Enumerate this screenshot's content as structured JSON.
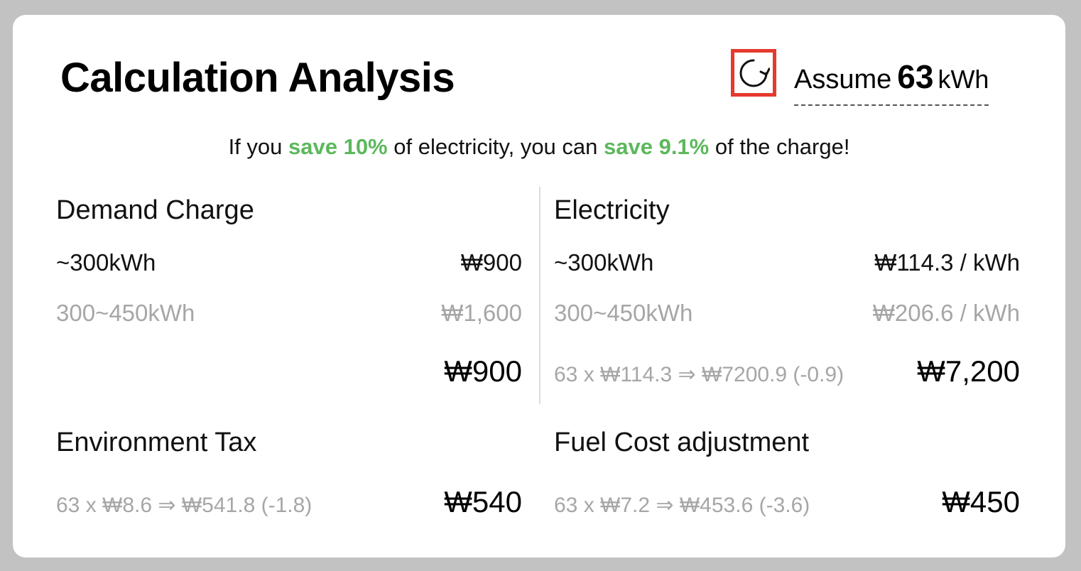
{
  "header": {
    "title": "Calculation Analysis",
    "assume_word": "Assume",
    "assume_value": "63",
    "assume_unit": "kWh"
  },
  "summary": {
    "part1": "If you ",
    "hl1": "save 10%",
    "part2": " of electricity, you can ",
    "hl2": "save 9.1%",
    "part3": " of the charge!"
  },
  "demand_charge": {
    "title": "Demand Charge",
    "tiers": [
      {
        "range": "~300kWh",
        "price": "₩900"
      },
      {
        "range": "300~450kWh",
        "price": "₩1,600"
      }
    ],
    "calc": "",
    "total": "₩900"
  },
  "electricity": {
    "title": "Electricity",
    "tiers": [
      {
        "range": "~300kWh",
        "price": "₩114.3 / kWh"
      },
      {
        "range": "300~450kWh",
        "price": "₩206.6 / kWh"
      }
    ],
    "calc": "63 x ₩114.3 ⇒ ₩7200.9 (-0.9)",
    "total": "₩7,200"
  },
  "environment_tax": {
    "title": "Environment Tax",
    "calc": "63 x ₩8.6 ⇒ ₩541.8 (-1.8)",
    "total": "₩540"
  },
  "fuel_cost": {
    "title": "Fuel Cost adjustment",
    "calc": "63 x ₩7.2 ⇒ ₩453.6 (-3.6)",
    "total": "₩450"
  },
  "colors": {
    "highlight": "#5cb85c",
    "focus_border": "#e53a2e",
    "dim_text": "#a6a6a6",
    "background": "#c2c2c2"
  },
  "icons": {
    "refresh": "refresh-icon"
  }
}
